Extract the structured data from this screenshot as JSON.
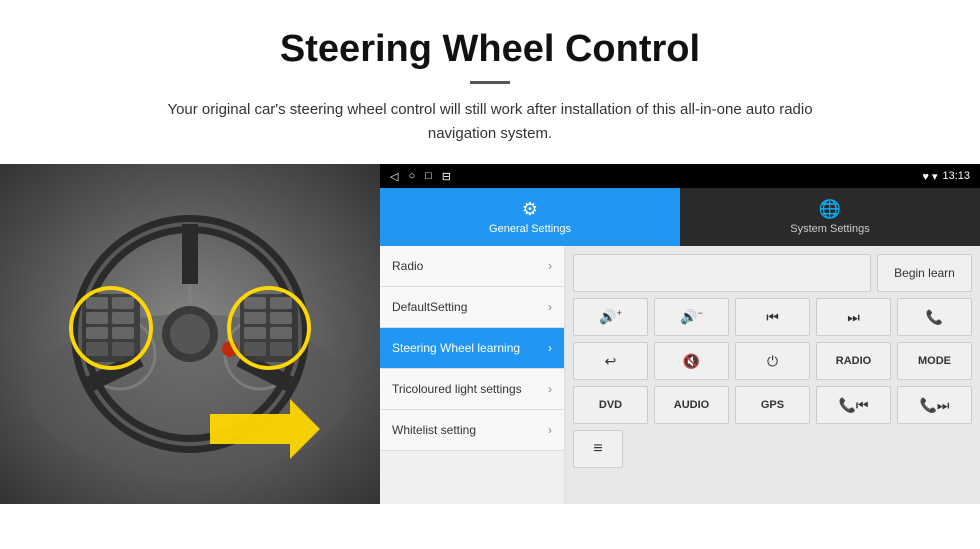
{
  "header": {
    "title": "Steering Wheel Control",
    "subtitle": "Your original car's steering wheel control will still work after installation of this all-in-one auto radio navigation system."
  },
  "status_bar": {
    "nav_icons": [
      "◁",
      "○",
      "□",
      "⊟"
    ],
    "right_icons": "♥ ▾",
    "time": "13:13"
  },
  "tabs": {
    "general": {
      "label": "General Settings",
      "icon": "⚙"
    },
    "system": {
      "label": "System Settings",
      "icon": "🌐"
    }
  },
  "menu": {
    "items": [
      {
        "label": "Radio",
        "active": false
      },
      {
        "label": "DefaultSetting",
        "active": false
      },
      {
        "label": "Steering Wheel learning",
        "active": true
      },
      {
        "label": "Tricoloured light settings",
        "active": false
      },
      {
        "label": "Whitelist setting",
        "active": false
      }
    ]
  },
  "controls": {
    "begin_learn": "Begin learn",
    "row2": [
      "🔊+",
      "🔊−",
      "⏮",
      "⏭",
      "📞"
    ],
    "row3": [
      "↩",
      "🔊x",
      "⏻",
      "RADIO",
      "MODE"
    ],
    "row4": [
      "DVD",
      "AUDIO",
      "GPS",
      "📞⏮",
      "📞⏭"
    ],
    "row5_icon": "≡"
  }
}
